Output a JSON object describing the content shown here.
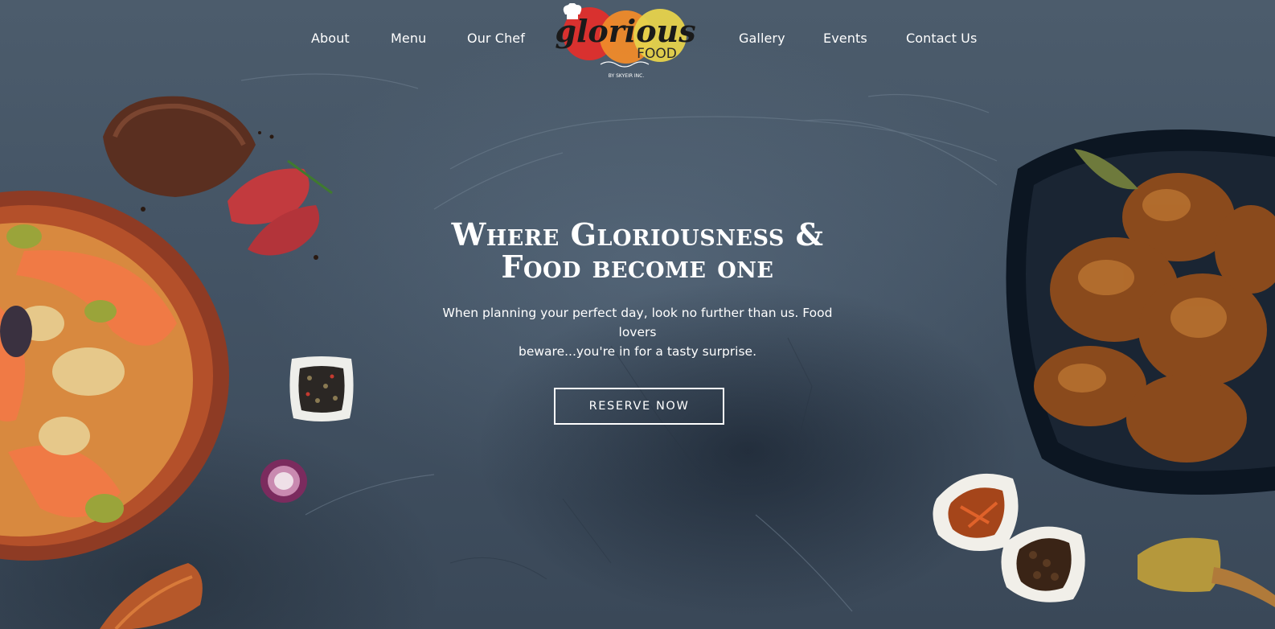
{
  "nav": {
    "left": [
      {
        "label": "About"
      },
      {
        "label": "Menu"
      },
      {
        "label": "Our Chef"
      }
    ],
    "right": [
      {
        "label": "Gallery"
      },
      {
        "label": "Events"
      },
      {
        "label": "Contact Us"
      }
    ]
  },
  "logo": {
    "word": "glorious",
    "sub": "FOOD",
    "tagline": "BY SKYEIR INC.",
    "colors": [
      "#d9312f",
      "#ef8a2a",
      "#e6d24c"
    ]
  },
  "hero": {
    "headline_line1": "Where Gloriousness &",
    "headline_line2": "Food become one",
    "subtext_line1": "When planning your perfect day, look no further than us. Food lovers",
    "subtext_line2": "beware...you're in for a tasty surprise.",
    "cta": "RESERVE NOW"
  },
  "decor": {
    "images": [
      "steak-image",
      "seafood-bowl-image",
      "peppercorn-dish-image",
      "red-onion-image",
      "spice-scoop-image",
      "chicken-platter-image",
      "chili-dish-image",
      "allspice-dish-image",
      "cumin-scoop-image"
    ]
  }
}
